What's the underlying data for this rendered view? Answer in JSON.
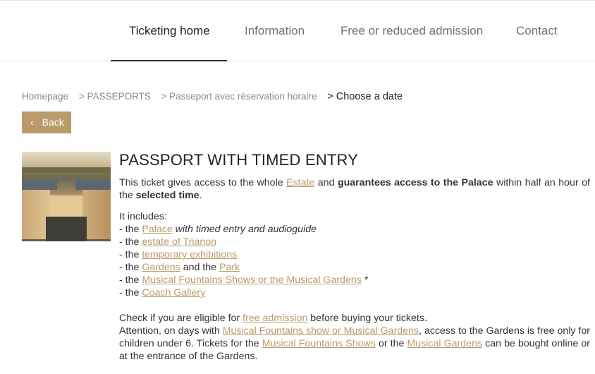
{
  "nav": {
    "items": [
      {
        "label": "Ticketing home",
        "active": true
      },
      {
        "label": "Information",
        "active": false
      },
      {
        "label": "Free or reduced admission",
        "active": false
      },
      {
        "label": "Contact",
        "active": false
      }
    ]
  },
  "breadcrumb": {
    "items": [
      "Homepage",
      "> PASSEPORTS",
      "> Passeport avec réservation horaire"
    ],
    "current": "> Choose a date"
  },
  "back_button": {
    "label": "Back",
    "icon": "chevron-left-icon"
  },
  "product": {
    "image_alt": "Palace of Versailles aerial view",
    "title": "PASSPORT WITH TIMED ENTRY",
    "intro": {
      "t1": "This ticket gives access to the whole ",
      "link_estate": "Estate",
      "t2": " and ",
      "bold1": "guarantees access to the Palace",
      "t3": " within half an hour of the ",
      "bold2": "selected time",
      "t4": "."
    },
    "includes_label": "It includes:",
    "includes": {
      "palace_prefix": "- the ",
      "palace_link": "Palace",
      "palace_suffix": " with timed entry and audioguide",
      "trianon_prefix": "- the ",
      "trianon_link": "estate of Trianon",
      "exhib_prefix": "- the ",
      "exhib_link": "temporary exhibitions",
      "gardens_prefix": "- the ",
      "gardens_link": "Gardens",
      "gardens_mid": " and the ",
      "park_link": "Park",
      "fountains_prefix": "- the ",
      "fountains_link": "Musical Fountains Shows or the Musical Gardens",
      "fountains_suffix": " *",
      "coach_prefix": "- the ",
      "coach_link": "Coach Gallery"
    },
    "check": {
      "t1": "Check if you are eligible for ",
      "link_free": "free admission",
      "t2": " before buying your tickets."
    },
    "attention": {
      "t1": "Attention, on days with ",
      "link1": "Musical Fountains show or Musical Gardens",
      "t2": ", access to the Gardens is free only for children under 6. Tickets for the ",
      "link2": "Musical Fountains Shows",
      "t3": " or the ",
      "link3": "Musical Gardens",
      "t4": " can be bought online or at the entrance of the Gardens."
    }
  },
  "colors": {
    "accent": "#b99b6a",
    "text": "#333333",
    "nav_inactive": "#707070"
  }
}
